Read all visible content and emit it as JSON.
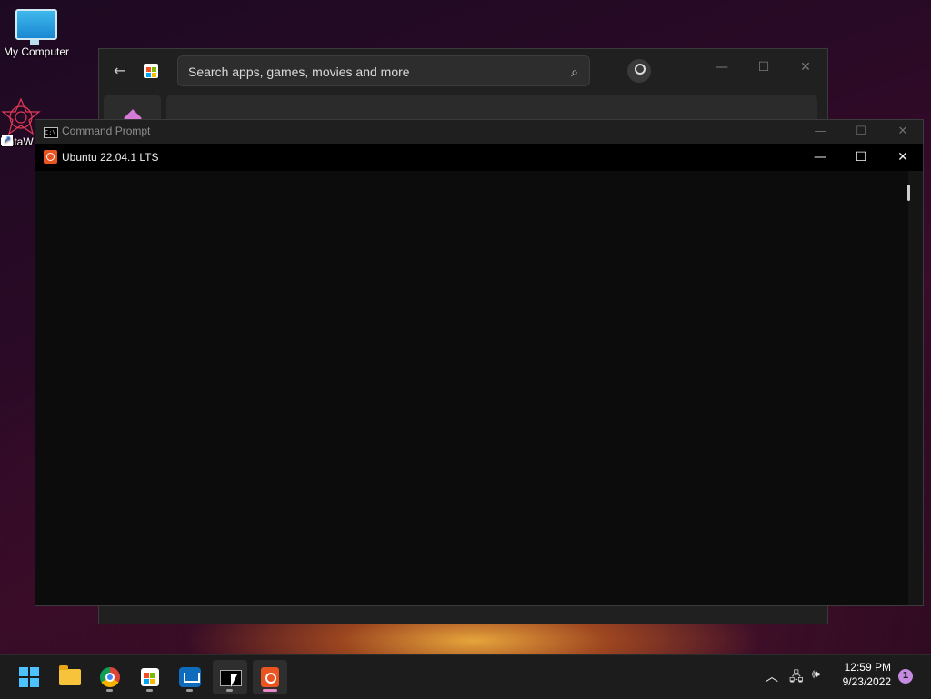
{
  "desktop": {
    "icons": [
      {
        "label": "My Computer"
      },
      {
        "label": "DataW"
      }
    ]
  },
  "store": {
    "search_placeholder": "Search apps, games, movies and more",
    "controls": {
      "minimize": "—",
      "maximize": "☐",
      "close": "✕"
    }
  },
  "cmd": {
    "title": "Command Prompt",
    "controls": {
      "minimize": "—",
      "maximize": "☐",
      "close": "✕"
    }
  },
  "ubuntu": {
    "title": "Ubuntu 22.04.1 LTS",
    "controls": {
      "minimize": "—",
      "maximize": "☐",
      "close": "✕"
    }
  },
  "taskbar": {
    "apps": [
      "start-icon",
      "file-explorer-icon",
      "chrome-icon",
      "microsoft-store-icon",
      "mail-icon",
      "command-prompt-icon",
      "ubuntu-icon"
    ]
  },
  "tray": {
    "time": "12:59 PM",
    "date": "9/23/2022",
    "notification_count": "1"
  },
  "colors": {
    "accent": "#4cc2ff",
    "ubuntu_orange": "#e95420",
    "terminal_bg": "#0c0c0c"
  }
}
